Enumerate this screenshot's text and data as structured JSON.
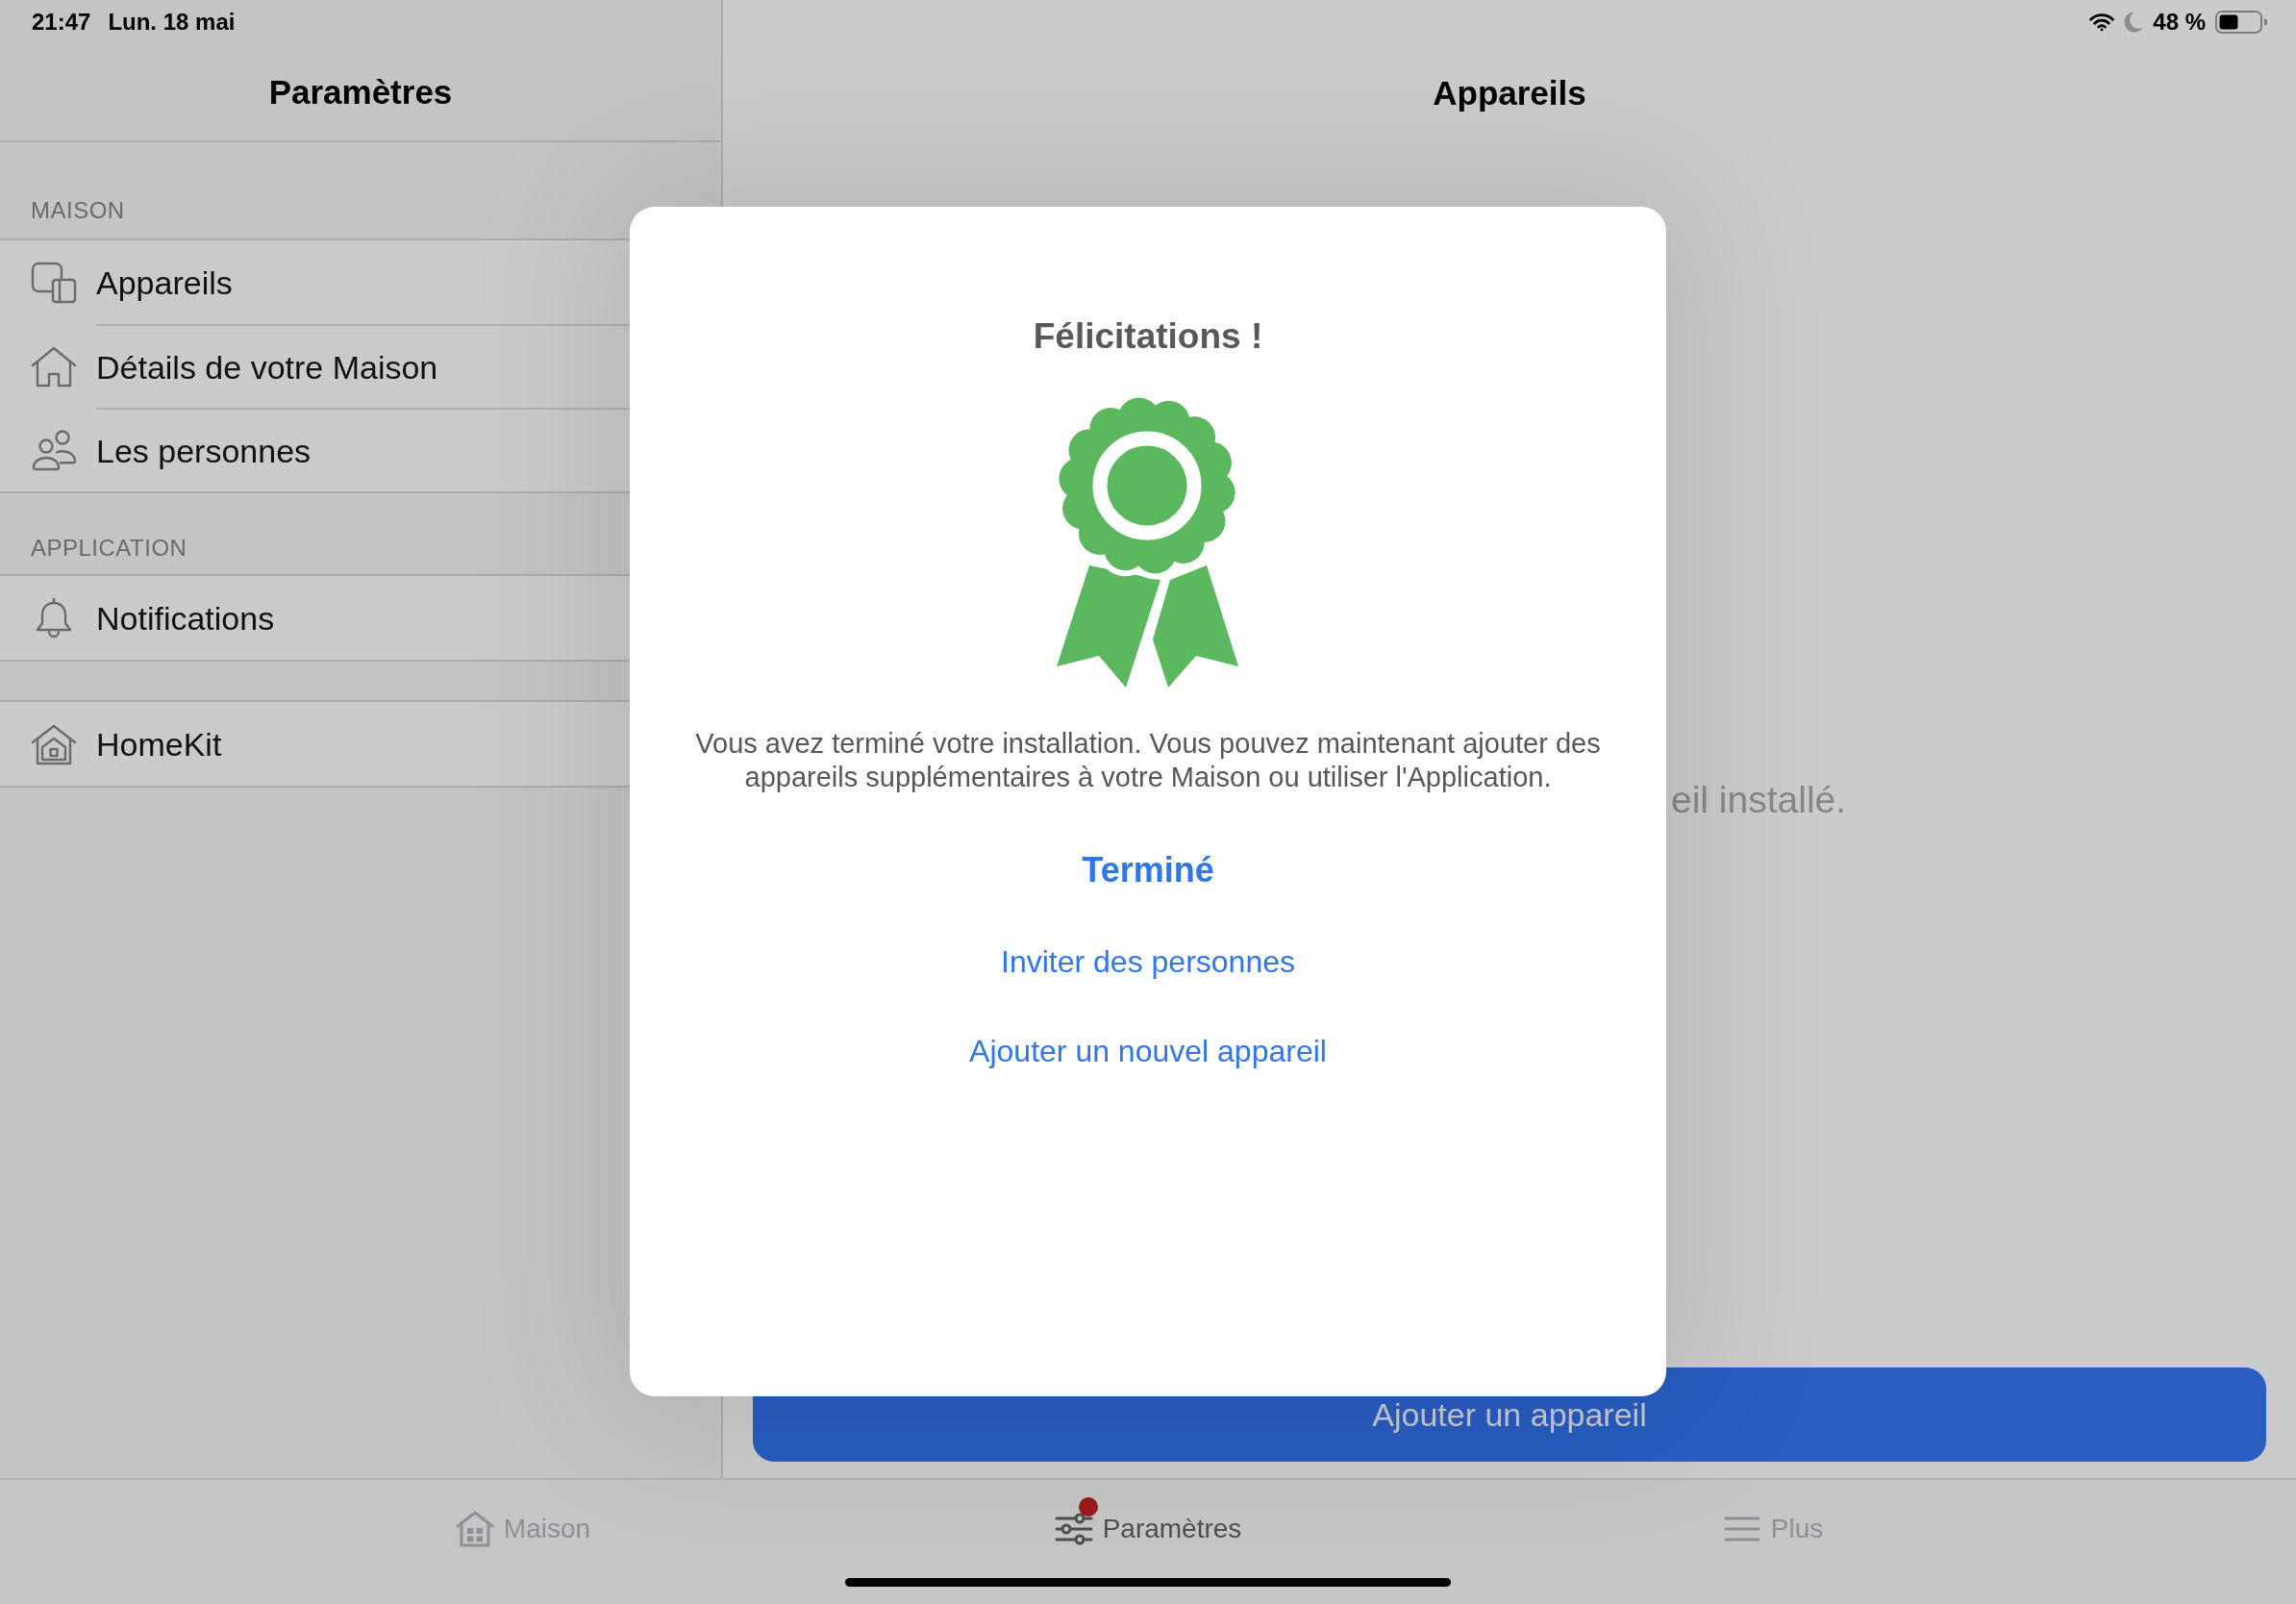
{
  "status_bar": {
    "time": "21:47",
    "date": "Lun. 18 mai",
    "battery": "48 %"
  },
  "sidebar": {
    "title": "Paramètres",
    "sections": [
      {
        "header": "MAISON",
        "items": [
          "Appareils",
          "Détails de votre Maison",
          "Les personnes"
        ]
      },
      {
        "header": "APPLICATION",
        "items": [
          "Notifications"
        ]
      },
      {
        "items": [
          "HomeKit"
        ]
      }
    ]
  },
  "content": {
    "title": "Appareils",
    "message": "eil installé.",
    "button": "Ajouter un appareil"
  },
  "dialog": {
    "title": "Félicitations !",
    "message": "Vous avez terminé votre installation. Vous pouvez maintenant ajouter des appareils supplémentaires à votre Maison ou utiliser l'Application.",
    "actions": [
      {
        "label": "Terminé",
        "primary": true
      },
      {
        "label": "Inviter des personnes",
        "primary": false
      },
      {
        "label": "Ajouter un nouvel appareil",
        "primary": false
      }
    ]
  },
  "tab_bar": {
    "tabs": [
      {
        "label": "Maison",
        "selected": false,
        "badge": false
      },
      {
        "label": "Paramètres",
        "selected": true,
        "badge": true
      },
      {
        "label": "Plus",
        "selected": false,
        "badge": false
      }
    ]
  }
}
